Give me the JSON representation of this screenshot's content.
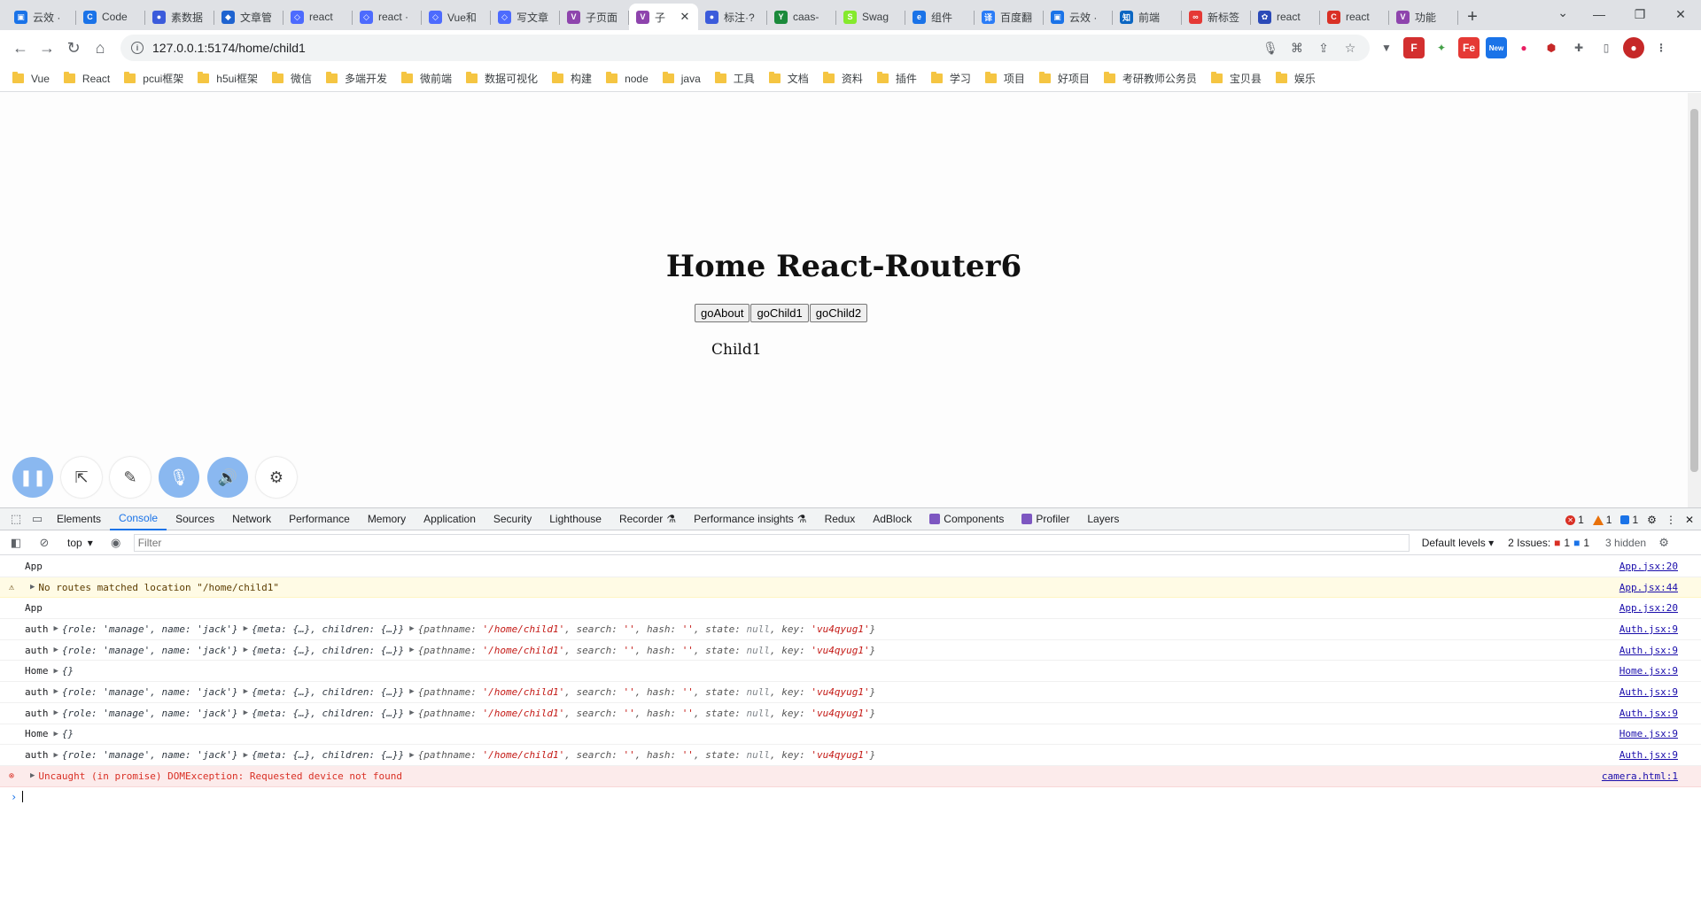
{
  "tabs": [
    {
      "label": "云效 ·",
      "color": "#1a73e8",
      "glyph": "▣"
    },
    {
      "label": "Code",
      "color": "#1a73e8",
      "glyph": "C"
    },
    {
      "label": "素数据",
      "color": "#3b5bdb",
      "glyph": "●"
    },
    {
      "label": "文章管",
      "color": "#1e63d0",
      "glyph": "◆"
    },
    {
      "label": "react",
      "color": "#4d6bfe",
      "glyph": "◇"
    },
    {
      "label": "react ·",
      "color": "#4d6bfe",
      "glyph": "◇"
    },
    {
      "label": "Vue和",
      "color": "#4d6bfe",
      "glyph": "◇"
    },
    {
      "label": "写文章",
      "color": "#4d6bfe",
      "glyph": "◇"
    },
    {
      "label": "子页面",
      "color": "#8e44ad",
      "glyph": "V"
    },
    {
      "label": "子",
      "color": "#8e44ad",
      "glyph": "V"
    },
    {
      "label": "标注·?",
      "color": "#3b5bdb",
      "glyph": "●"
    },
    {
      "label": "caas-",
      "color": "#1b8a3b",
      "glyph": "Y"
    },
    {
      "label": "Swag",
      "color": "#85ea2d",
      "glyph": "S"
    },
    {
      "label": "组件",
      "color": "#1a73e8",
      "glyph": "e"
    },
    {
      "label": "百度翻",
      "color": "#2a7cf7",
      "glyph": "译"
    },
    {
      "label": "云效 ·",
      "color": "#1a73e8",
      "glyph": "▣"
    },
    {
      "label": "前端",
      "color": "#0b66c2",
      "glyph": "知"
    },
    {
      "label": "新标签",
      "color": "#e53935",
      "glyph": "∞"
    },
    {
      "label": "react",
      "color": "#2b4ab8",
      "glyph": "✿"
    },
    {
      "label": "react",
      "color": "#d93025",
      "glyph": "C"
    },
    {
      "label": "功能",
      "color": "#8e44ad",
      "glyph": "V"
    }
  ],
  "address": {
    "url": "127.0.0.1:5174/home/child1"
  },
  "bookmarks": [
    "Vue",
    "React",
    "pcui框架",
    "h5ui框架",
    "微信",
    "多端开发",
    "微前端",
    "数据可视化",
    "构建",
    "node",
    "java",
    "工具",
    "文档",
    "资料",
    "插件",
    "学习",
    "项目",
    "好项目",
    "考研教师公务员",
    "宝贝县",
    "娱乐"
  ],
  "page": {
    "title": "Home React-Router6",
    "buttons": [
      "goAbout",
      "goChild1",
      "goChild2"
    ],
    "child": "Child1"
  },
  "devtools": {
    "tabs": [
      "Elements",
      "Console",
      "Sources",
      "Network",
      "Performance",
      "Memory",
      "Application",
      "Security",
      "Lighthouse",
      "Recorder",
      "Performance insights",
      "Redux",
      "AdBlock",
      "Components",
      "Profiler",
      "Layers"
    ],
    "errors": "1",
    "warnings": "1",
    "infos": "1",
    "context": "top",
    "filter_placeholder": "Filter",
    "levels": "Default levels",
    "issues_label": "2 Issues:",
    "issues_err": "1",
    "issues_info": "1",
    "hidden": "3 hidden"
  },
  "console": [
    {
      "level": "log",
      "prefix": "App",
      "body": "",
      "src": "App.jsx:20"
    },
    {
      "level": "warn",
      "prefix": "",
      "body": "No routes matched location \"/home/child1\"",
      "src": "App.jsx:44"
    },
    {
      "level": "log",
      "prefix": "App",
      "body": "",
      "src": "App.jsx:20"
    },
    {
      "level": "log",
      "prefix": "auth",
      "body": "auth",
      "src": "Auth.jsx:9"
    },
    {
      "level": "log",
      "prefix": "auth",
      "body": "auth",
      "src": "Auth.jsx:9"
    },
    {
      "level": "log",
      "prefix": "Home",
      "body": "{}",
      "src": "Home.jsx:9"
    },
    {
      "level": "log",
      "prefix": "auth",
      "body": "auth",
      "src": "Auth.jsx:9"
    },
    {
      "level": "log",
      "prefix": "auth",
      "body": "auth",
      "src": "Auth.jsx:9"
    },
    {
      "level": "log",
      "prefix": "Home",
      "body": "{}",
      "src": "Home.jsx:9"
    },
    {
      "level": "log",
      "prefix": "auth",
      "body": "auth",
      "src": "Auth.jsx:9"
    },
    {
      "level": "error",
      "prefix": "",
      "body": "Uncaught (in promise) DOMException: Requested device not found",
      "src": "camera.html:1"
    }
  ],
  "auth_line": {
    "obj1": "{role: 'manage', name: 'jack'}",
    "obj2": "{meta: {…}, children: {…}}",
    "obj3_pre": "{pathname: ",
    "pathname": "'/home/child1'",
    "obj3_mid": ", search: ",
    "search": "''",
    "obj3_hash": ", hash: ",
    "hash": "''",
    "obj3_state": ", state: ",
    "state": "null",
    "obj3_key": ", key: ",
    "key": "'vu4qyug1'",
    "obj3_end": "}"
  }
}
